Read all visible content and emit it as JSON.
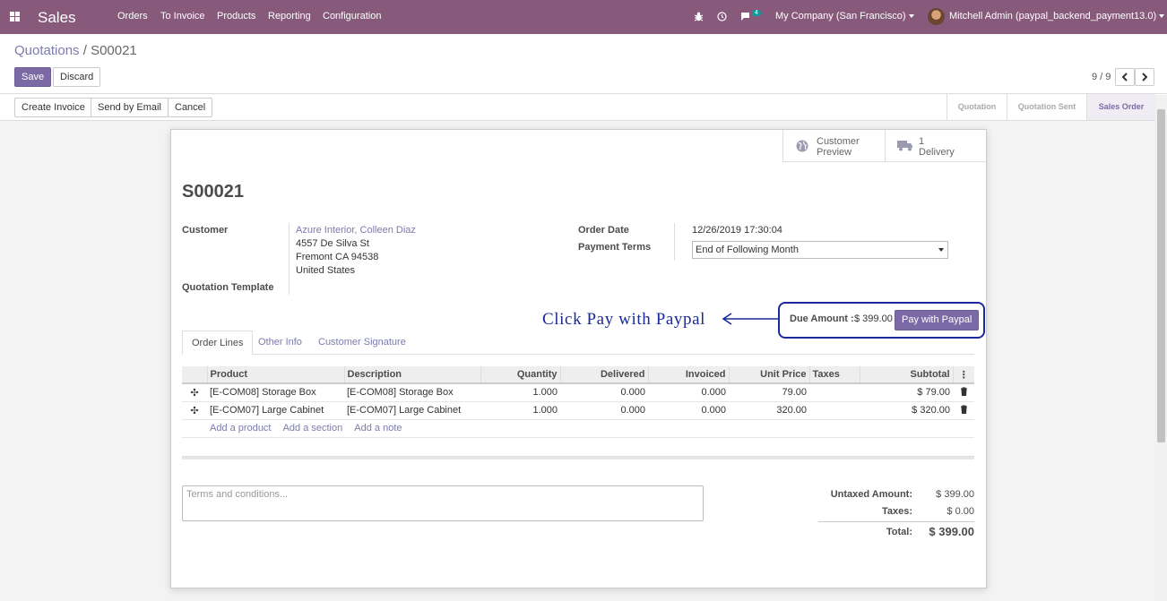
{
  "nav": {
    "app_name": "Sales",
    "menu": [
      "Orders",
      "To Invoice",
      "Products",
      "Reporting",
      "Configuration"
    ],
    "message_count": "4",
    "company": "My Company (San Francisco)",
    "user": "Mitchell Admin (paypal_backend_payment13.0)"
  },
  "control_panel": {
    "breadcrumb_parent": "Quotations",
    "breadcrumb_sep": "/",
    "breadcrumb_current": "S00021",
    "save_label": "Save",
    "discard_label": "Discard",
    "pager": "9 / 9"
  },
  "statusbar": {
    "buttons": [
      "Create Invoice",
      "Send by Email",
      "Cancel"
    ],
    "stages": [
      "Quotation",
      "Quotation Sent",
      "Sales Order"
    ],
    "active_stage": "Sales Order"
  },
  "smart_buttons": {
    "preview_line1": "Customer",
    "preview_line2": "Preview",
    "delivery_count": "1",
    "delivery_label": "Delivery"
  },
  "order": {
    "name": "S00021",
    "customer_label": "Customer",
    "customer_name": "Azure Interior, Colleen Diaz",
    "address": [
      "4557 De Silva St",
      "Fremont CA 94538",
      "United States"
    ],
    "template_label": "Quotation Template",
    "order_date_label": "Order Date",
    "order_date": "12/26/2019 17:30:04",
    "payment_terms_label": "Payment Terms",
    "payment_terms": "End of Following Month"
  },
  "annotation": "Click Pay with Paypal",
  "due": {
    "label": "Due Amount :",
    "amount": "$ 399.00",
    "pay_button": "Pay with Paypal"
  },
  "tabs": [
    "Order Lines",
    "Other Info",
    "Customer Signature"
  ],
  "lines": {
    "headers": [
      "Product",
      "Description",
      "Quantity",
      "Delivered",
      "Invoiced",
      "Unit Price",
      "Taxes",
      "Subtotal"
    ],
    "rows": [
      {
        "product": "[E-COM08] Storage Box",
        "description": "[E-COM08] Storage Box",
        "quantity": "1.000",
        "delivered": "0.000",
        "invoiced": "0.000",
        "unit_price": "79.00",
        "taxes": "",
        "subtotal": "$ 79.00"
      },
      {
        "product": "[E-COM07] Large Cabinet",
        "description": "[E-COM07] Large Cabinet",
        "quantity": "1.000",
        "delivered": "0.000",
        "invoiced": "0.000",
        "unit_price": "320.00",
        "taxes": "",
        "subtotal": "$ 320.00"
      }
    ],
    "add_product": "Add a product",
    "add_section": "Add a section",
    "add_note": "Add a note"
  },
  "terms_placeholder": "Terms and conditions...",
  "totals": {
    "untaxed_label": "Untaxed Amount:",
    "untaxed": "$ 399.00",
    "taxes_label": "Taxes:",
    "taxes": "$ 0.00",
    "total_label": "Total:",
    "total": "$ 399.00"
  },
  "colors": {
    "brand": "#875a7b",
    "primary": "#7c6aa6",
    "link": "#7c7bad",
    "annotation": "#1a2a9a"
  }
}
